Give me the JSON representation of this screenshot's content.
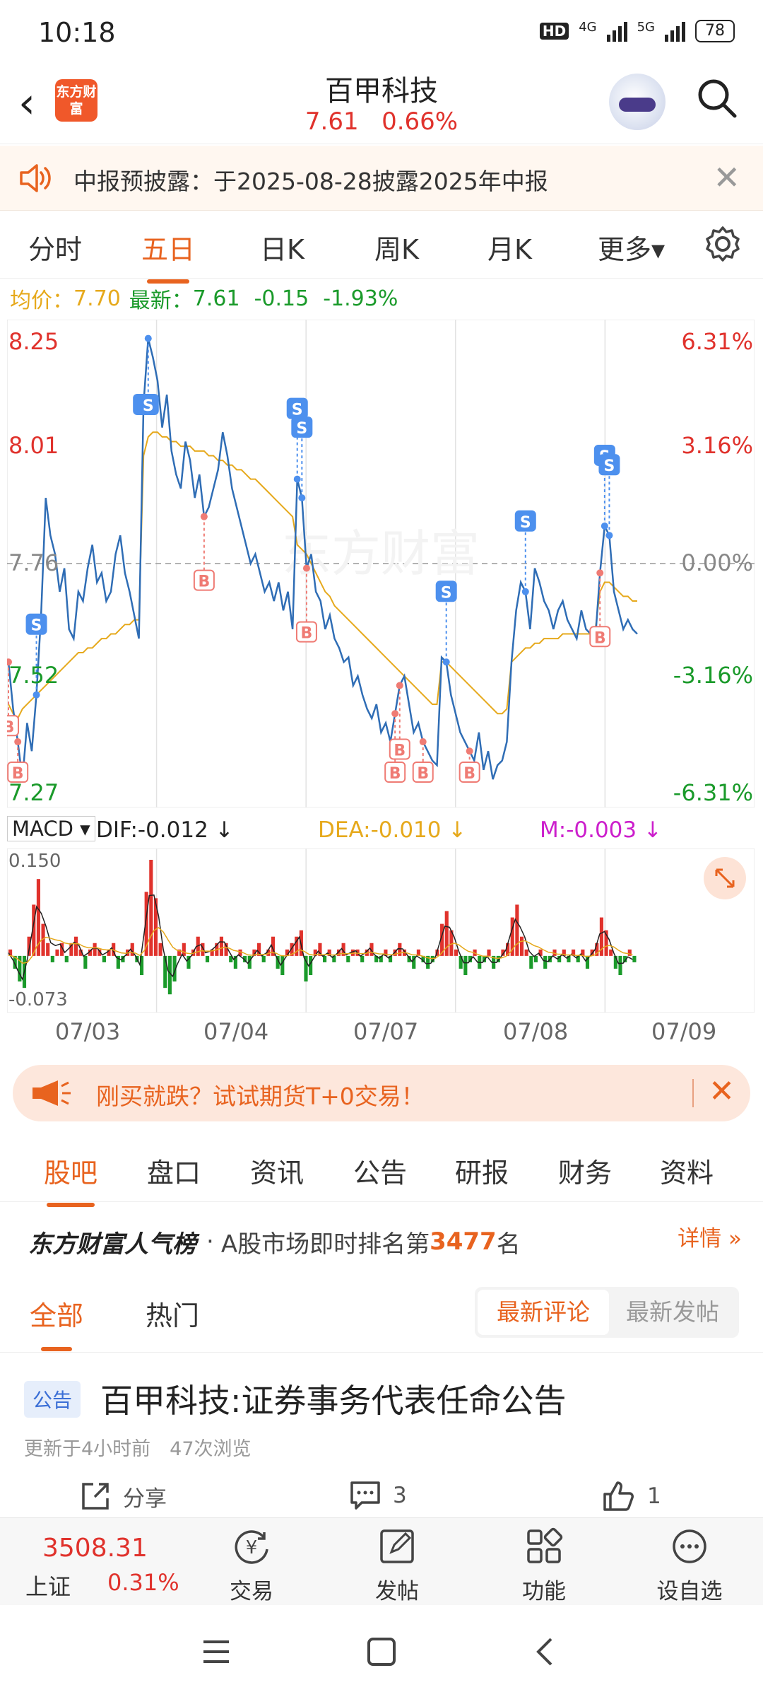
{
  "status_bar": {
    "time": "10:18",
    "net1": "4G",
    "net2": "5G",
    "battery": "78",
    "hd": "HD"
  },
  "header": {
    "back": "‹",
    "logo": "东方财富",
    "title": "百甲科技",
    "price": "7.61",
    "change_pct": "0.66%"
  },
  "notice": {
    "text": "中报预披露：于2025-08-28披露2025年中报",
    "close": "✕"
  },
  "period_tabs": [
    "分时",
    "五日",
    "日K",
    "周K",
    "月K",
    "更多▾"
  ],
  "period_active": "五日",
  "info": {
    "avg_label": "均价：",
    "avg": "7.70",
    "latest_label": "最新：",
    "latest": "7.61",
    "chg": "-0.15",
    "chg_pct": "-1.93%"
  },
  "chart_data": [
    {
      "type": "line",
      "title": "",
      "x": [
        "07/03",
        "07/04",
        "07/07",
        "07/08",
        "07/09"
      ],
      "y_left_ticks": [
        "8.25",
        "8.01",
        "7.76",
        "7.52",
        "7.27"
      ],
      "y_right_ticks": [
        "6.31%",
        "3.16%",
        "0.00%",
        "-3.16%",
        "-6.31%"
      ],
      "ylim": [
        7.27,
        8.25
      ],
      "prev_close": 7.76,
      "series": [
        {
          "name": "",
          "values": [
            7.55,
            7.45,
            7.38,
            7.3,
            7.42,
            7.36,
            7.48,
            7.65,
            7.9,
            7.82,
            7.78,
            7.7,
            7.75,
            7.62,
            7.6,
            7.7,
            7.68,
            7.75,
            7.8,
            7.72,
            7.74,
            7.68,
            7.7,
            7.78,
            7.82,
            7.74,
            7.7,
            7.65,
            7.6,
            8.1,
            8.24,
            8.2,
            8.15,
            8.05,
            8.12,
            8.0,
            7.95,
            7.92,
            8.02,
            7.98,
            7.9,
            7.95,
            7.86,
            7.88,
            7.92,
            7.96,
            8.04,
            7.99,
            7.92,
            7.88,
            7.84,
            7.8,
            7.76,
            7.78,
            7.74,
            7.7,
            7.72,
            7.68,
            7.72,
            7.66,
            7.7,
            7.62,
            7.94,
            7.9,
            7.75,
            7.78,
            7.7,
            7.68,
            7.62,
            7.65,
            7.6,
            7.58,
            7.55,
            7.56,
            7.5,
            7.52,
            7.48,
            7.45,
            7.43,
            7.46,
            7.4,
            7.42,
            7.38,
            7.44,
            7.5,
            7.52,
            7.46,
            7.4,
            7.42,
            7.38,
            7.36,
            7.34,
            7.33,
            7.56,
            7.55,
            7.48,
            7.44,
            7.4,
            7.38,
            7.36,
            7.34,
            7.4,
            7.32,
            7.36,
            7.3,
            7.33,
            7.34,
            7.38,
            7.55,
            7.66,
            7.72,
            7.7,
            7.62,
            7.75,
            7.72,
            7.68,
            7.66,
            7.62,
            7.66,
            7.68,
            7.64,
            7.62,
            7.6,
            7.66,
            7.62,
            7.61,
            7.6,
            7.74,
            7.84,
            7.82,
            7.7,
            7.66,
            7.62,
            7.64,
            7.62,
            7.61
          ]
        },
        {
          "name": "",
          "values": [
            7.46,
            7.44,
            7.43,
            7.45,
            7.46,
            7.47,
            7.48,
            7.49,
            7.5,
            7.51,
            7.52,
            7.53,
            7.54,
            7.55,
            7.56,
            7.57,
            7.57,
            7.58,
            7.58,
            7.59,
            7.6,
            7.6,
            7.61,
            7.61,
            7.62,
            7.63,
            7.63,
            7.64,
            7.64,
            7.99,
            8.03,
            8.04,
            8.04,
            8.03,
            8.03,
            8.02,
            8.02,
            8.01,
            8.01,
            8.01,
            8.0,
            8.0,
            8.0,
            7.99,
            7.99,
            7.98,
            7.98,
            7.97,
            7.97,
            7.96,
            7.96,
            7.95,
            7.94,
            7.94,
            7.93,
            7.92,
            7.91,
            7.9,
            7.89,
            7.88,
            7.87,
            7.86,
            7.8,
            7.79,
            7.78,
            7.76,
            7.74,
            7.72,
            7.7,
            7.69,
            7.67,
            7.66,
            7.65,
            7.64,
            7.63,
            7.62,
            7.61,
            7.6,
            7.59,
            7.58,
            7.57,
            7.56,
            7.55,
            7.54,
            7.53,
            7.52,
            7.51,
            7.5,
            7.49,
            7.48,
            7.47,
            7.46,
            7.46,
            7.55,
            7.55,
            7.54,
            7.53,
            7.52,
            7.51,
            7.5,
            7.49,
            7.48,
            7.47,
            7.46,
            7.45,
            7.44,
            7.44,
            7.45,
            7.55,
            7.56,
            7.57,
            7.58,
            7.58,
            7.59,
            7.59,
            7.6,
            7.6,
            7.6,
            7.6,
            7.61,
            7.61,
            7.61,
            7.61,
            7.61,
            7.61,
            7.61,
            7.62,
            7.7,
            7.72,
            7.72,
            7.71,
            7.7,
            7.69,
            7.69,
            7.68,
            7.68
          ]
        }
      ],
      "markers_s": [
        6,
        29,
        30,
        62,
        63,
        94,
        111,
        128,
        129
      ],
      "markers_b": [
        0,
        2,
        42,
        64,
        83,
        84,
        89,
        99,
        127
      ],
      "watermark": "东方财富"
    },
    {
      "type": "bar",
      "title": "",
      "indicator": "MACD",
      "ylim": [
        -0.073,
        0.15
      ],
      "y_ticks": [
        "0.150",
        "-0.073"
      ],
      "values": [
        0.01,
        -0.02,
        -0.04,
        -0.05,
        0.03,
        0.08,
        0.12,
        0.05,
        0.02,
        -0.01,
        0.01,
        0.02,
        -0.01,
        0.02,
        0.03,
        0.01,
        -0.02,
        0.01,
        0.02,
        0.01,
        -0.01,
        0.01,
        0.02,
        -0.02,
        -0.01,
        0.01,
        0.02,
        -0.01,
        -0.03,
        0.1,
        0.15,
        0.09,
        0.02,
        -0.05,
        -0.06,
        -0.04,
        0.01,
        0.02,
        -0.02,
        0.01,
        0.03,
        0.02,
        -0.01,
        0.01,
        0.02,
        0.03,
        0.02,
        -0.01,
        -0.02,
        0.01,
        -0.01,
        -0.02,
        0.01,
        0.02,
        -0.01,
        0.01,
        0.03,
        -0.02,
        -0.03,
        0.01,
        0.02,
        0.03,
        0.04,
        -0.04,
        -0.03,
        0.01,
        0.02,
        -0.01,
        0.01,
        -0.01,
        0.01,
        0.02,
        -0.01,
        0.01,
        0.01,
        -0.01,
        0.01,
        0.02,
        -0.01,
        -0.01,
        0.01,
        -0.01,
        0.01,
        0.02,
        0.01,
        -0.01,
        -0.02,
        0.01,
        -0.01,
        -0.02,
        -0.01,
        0.01,
        0.05,
        0.07,
        0.04,
        0.01,
        -0.02,
        -0.03,
        -0.01,
        0.01,
        -0.02,
        -0.01,
        0.01,
        -0.02,
        -0.01,
        0.01,
        0.02,
        0.06,
        0.08,
        0.03,
        0.01,
        -0.02,
        -0.01,
        0.01,
        -0.02,
        -0.01,
        0.01,
        -0.01,
        0.01,
        -0.01,
        0.01,
        -0.01,
        0.01,
        -0.02,
        0.01,
        0.02,
        0.06,
        0.04,
        0.01,
        -0.02,
        -0.03,
        -0.01,
        0.01,
        -0.01
      ],
      "labels": {
        "macd": "MACD",
        "dif": "DIF:-0.012",
        "dea": "DEA:-0.010",
        "m": "M:-0.003"
      }
    }
  ],
  "colors": {
    "accent": "#e8631f",
    "up": "#e0322c",
    "down": "#1a9a2a",
    "price_line": "#2f6db5",
    "avg_line": "#e6a91c",
    "marker_s": "#4d90ee",
    "marker_b": "#ef7b74",
    "macd_m": "#cc1fcc",
    "dea": "#e6a91c"
  },
  "dates": [
    "07/03",
    "07/04",
    "07/07",
    "07/08",
    "07/09"
  ],
  "ad": {
    "text": "刚买就跌？试试期货T+0交易！",
    "close": "✕"
  },
  "section_tabs": [
    "股吧",
    "盘口",
    "资讯",
    "公告",
    "研报",
    "财务",
    "资料"
  ],
  "rank": {
    "brand": "东方财富人气榜",
    "dot": "·",
    "desc": "A股市场即时排名第",
    "num": "3477",
    "unit": "名",
    "more": "详情 »"
  },
  "filter": {
    "all": "全部",
    "hot": "热门",
    "latest_comment": "最新评论",
    "latest_post": "最新发帖"
  },
  "post": {
    "badge": "公告",
    "title": "百甲科技:证券事务代表任命公告",
    "meta": "更新于4小时前　47次浏览",
    "share": "分享",
    "comments": "3",
    "likes": "1"
  },
  "bottom": {
    "index_value": "3508.31",
    "index_name": "上证",
    "index_pct": "0.31%",
    "trade": "交易",
    "post": "发帖",
    "func": "功能",
    "watch": "设自选"
  }
}
